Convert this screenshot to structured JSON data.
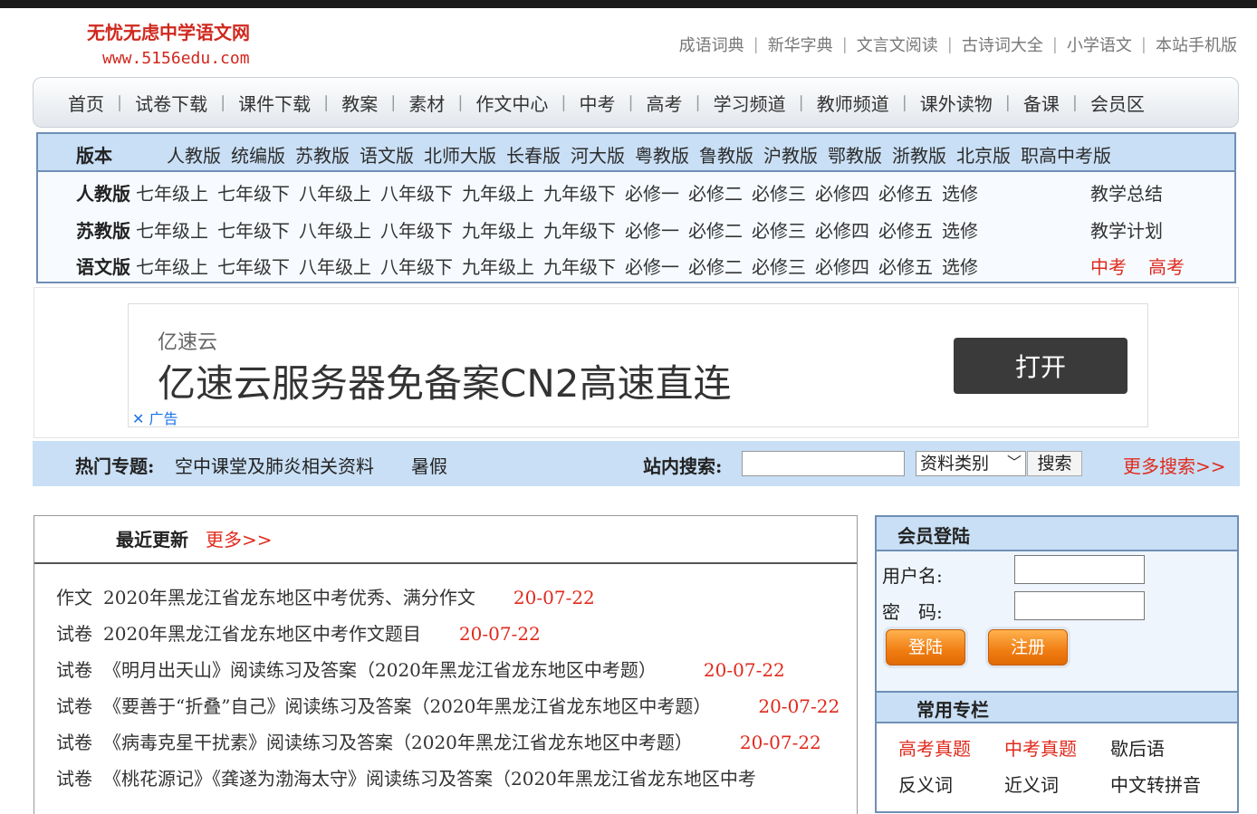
{
  "site": {
    "name": "无忧无虑中学语文网",
    "url": "www.5156edu.com"
  },
  "top_links": [
    "成语词典",
    "新华字典",
    "文言文阅读",
    "古诗词大全",
    "小学语文",
    "本站手机版"
  ],
  "nav": [
    "首页",
    "试卷下载",
    "课件下载",
    "教案",
    "素材",
    "作文中心",
    "中考",
    "高考",
    "学习频道",
    "教师频道",
    "课外读物",
    "备课",
    "会员区"
  ],
  "versions": {
    "label": "版本",
    "items": [
      "人教版",
      "统编版",
      "苏教版",
      "语文版",
      "北师大版",
      "长春版",
      "河大版",
      "粤教版",
      "鲁教版",
      "沪教版",
      "鄂教版",
      "浙教版",
      "北京版",
      "职高中考版"
    ],
    "grades": [
      "七年级上",
      "七年级下",
      "八年级上",
      "八年级下",
      "九年级上",
      "九年级下",
      "必修一",
      "必修二",
      "必修三",
      "必修四",
      "必修五",
      "选修"
    ],
    "rows": [
      {
        "label": "人教版",
        "extra": [
          "教学总结"
        ]
      },
      {
        "label": "苏教版",
        "extra": [
          "教学计划"
        ]
      },
      {
        "label": "语文版",
        "extra": [
          "中考",
          "高考"
        ]
      }
    ]
  },
  "ad": {
    "brand": "亿速云",
    "title": "亿速云服务器免备案CN2高速直连",
    "button": "打开",
    "tag": "广告",
    "close": "✕"
  },
  "hot": {
    "label": "热门专题:",
    "topics": [
      "空中课堂及肺炎相关资料",
      "暑假"
    ],
    "search_label": "站内搜索:",
    "search_value": "",
    "category": "资料类别",
    "search_button": "搜索",
    "more": "更多搜索>>"
  },
  "news": {
    "title": "最近更新",
    "more": "更多>>",
    "items": [
      {
        "cat": "作文",
        "title": "2020年黑龙江省龙东地区中考优秀、满分作文",
        "date": "20-07-22"
      },
      {
        "cat": "试卷",
        "title": "2020年黑龙江省龙东地区中考作文题目",
        "date": "20-07-22"
      },
      {
        "cat": "试卷",
        "title": "《明月出天山》阅读练习及答案（2020年黑龙江省龙东地区中考题）",
        "date": "20-07-22"
      },
      {
        "cat": "试卷",
        "title": "《要善于“折叠”自己》阅读练习及答案（2020年黑龙江省龙东地区中考题）",
        "date": "20-07-22"
      },
      {
        "cat": "试卷",
        "title": "《病毒克星干扰素》阅读练习及答案（2020年黑龙江省龙东地区中考题）",
        "date": "20-07-22"
      },
      {
        "cat": "试卷",
        "title": "《桃花源记》《龚遂为渤海太守》阅读练习及答案（2020年黑龙江省龙东地区中考",
        "date": ""
      }
    ]
  },
  "login": {
    "title": "会员登陆",
    "user_label": "用户名:",
    "pass_label": "密　码:",
    "login_button": "登陆",
    "register_button": "注册"
  },
  "columns": {
    "title": "常用专栏",
    "rows": [
      [
        {
          "text": "高考真题",
          "red": true
        },
        {
          "text": "中考真题",
          "red": true
        },
        {
          "text": "歇后语",
          "red": false
        }
      ],
      [
        {
          "text": "反义词",
          "red": false
        },
        {
          "text": "近义词",
          "red": false
        },
        {
          "text": "中文转拼音",
          "red": false
        }
      ]
    ]
  }
}
